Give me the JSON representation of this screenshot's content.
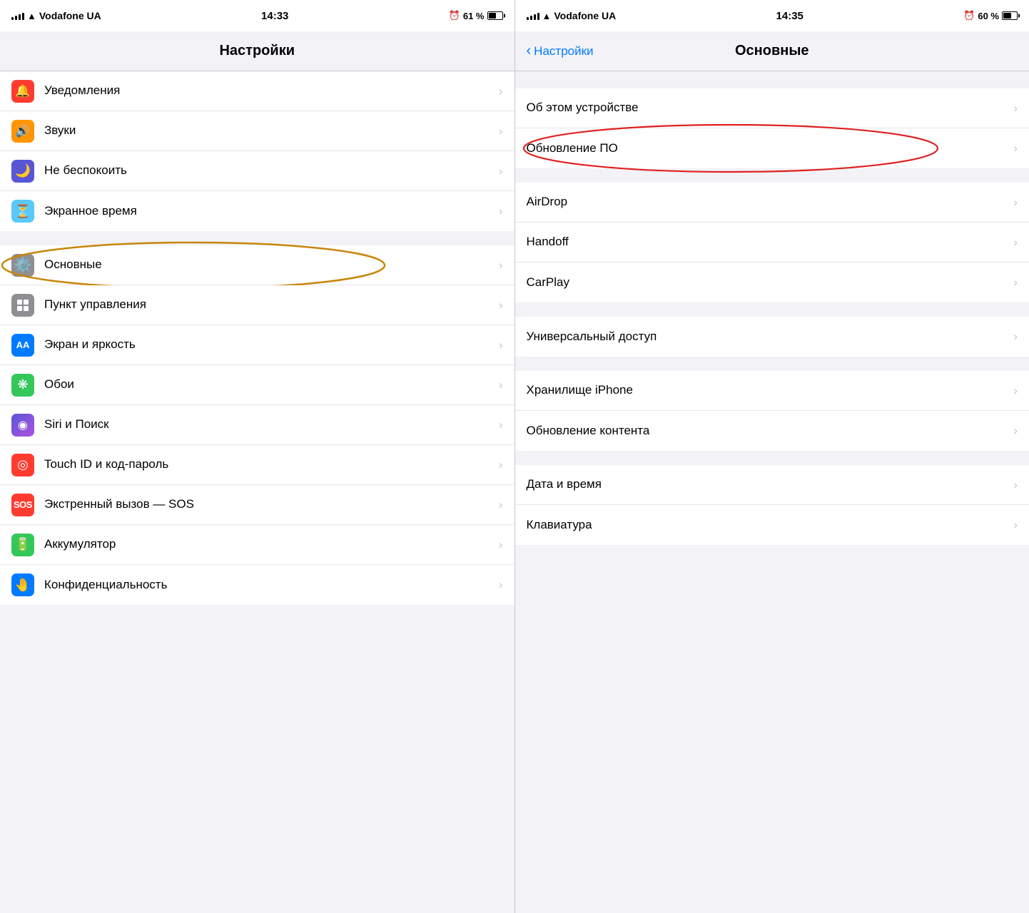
{
  "left_panel": {
    "status_bar": {
      "carrier": "Vodafone UA",
      "time": "14:33",
      "battery_percent": "61 %"
    },
    "title": "Настройки",
    "rows": [
      {
        "id": "notifications",
        "label": "Уведомления",
        "icon_bg": "#ff3b30",
        "icon": "🔔",
        "section": 0
      },
      {
        "id": "sounds",
        "label": "Звуки",
        "icon_bg": "#ff9500",
        "icon": "🔊",
        "section": 0
      },
      {
        "id": "dnd",
        "label": "Не беспокоить",
        "icon_bg": "#5856d6",
        "icon": "🌙",
        "section": 0
      },
      {
        "id": "screentime",
        "label": "Экранное время",
        "icon_bg": "#5ac8fa",
        "icon": "⌛",
        "section": 0
      },
      {
        "id": "general",
        "label": "Основные",
        "icon_bg": "#8e8e93",
        "icon": "⚙️",
        "section": 1,
        "highlighted": true
      },
      {
        "id": "controlcenter",
        "label": "Пункт управления",
        "icon_bg": "#8e8e93",
        "icon": "⊞",
        "section": 1
      },
      {
        "id": "display",
        "label": "Экран и яркость",
        "icon_bg": "#007aff",
        "icon": "AA",
        "section": 1
      },
      {
        "id": "wallpaper",
        "label": "Обои",
        "icon_bg": "#34c759",
        "icon": "❋",
        "section": 1
      },
      {
        "id": "siri",
        "label": "Siri и Поиск",
        "icon_bg": "#5856d6",
        "icon": "◉",
        "section": 1
      },
      {
        "id": "touchid",
        "label": "Touch ID и код-пароль",
        "icon_bg": "#ff3b30",
        "icon": "◎",
        "section": 1
      },
      {
        "id": "sos",
        "label": "Экстренный вызов — SOS",
        "icon_bg": "#ff3b30",
        "icon": "SOS",
        "section": 1
      },
      {
        "id": "battery",
        "label": "Аккумулятор",
        "icon_bg": "#34c759",
        "icon": "🔋",
        "section": 1
      },
      {
        "id": "privacy",
        "label": "Конфиденциальность",
        "icon_bg": "#007aff",
        "icon": "🤚",
        "section": 1
      }
    ]
  },
  "right_panel": {
    "status_bar": {
      "carrier": "Vodafone UA",
      "time": "14:35",
      "battery_percent": "60 %"
    },
    "back_label": "Настройки",
    "title": "Основные",
    "sections": [
      {
        "rows": [
          {
            "id": "about",
            "label": "Об этом устройстве"
          },
          {
            "id": "software_update",
            "label": "Обновление ПО",
            "highlighted": true
          }
        ]
      },
      {
        "rows": [
          {
            "id": "airdrop",
            "label": "AirDrop"
          },
          {
            "id": "handoff",
            "label": "Handoff"
          },
          {
            "id": "carplay",
            "label": "CarPlay"
          }
        ]
      },
      {
        "rows": [
          {
            "id": "accessibility",
            "label": "Универсальный доступ"
          }
        ]
      },
      {
        "rows": [
          {
            "id": "iphone_storage",
            "label": "Хранилище iPhone"
          },
          {
            "id": "bg_refresh",
            "label": "Обновление контента"
          }
        ]
      },
      {
        "rows": [
          {
            "id": "datetime",
            "label": "Дата и время"
          },
          {
            "id": "keyboard",
            "label": "Клавиатура"
          }
        ]
      }
    ]
  }
}
